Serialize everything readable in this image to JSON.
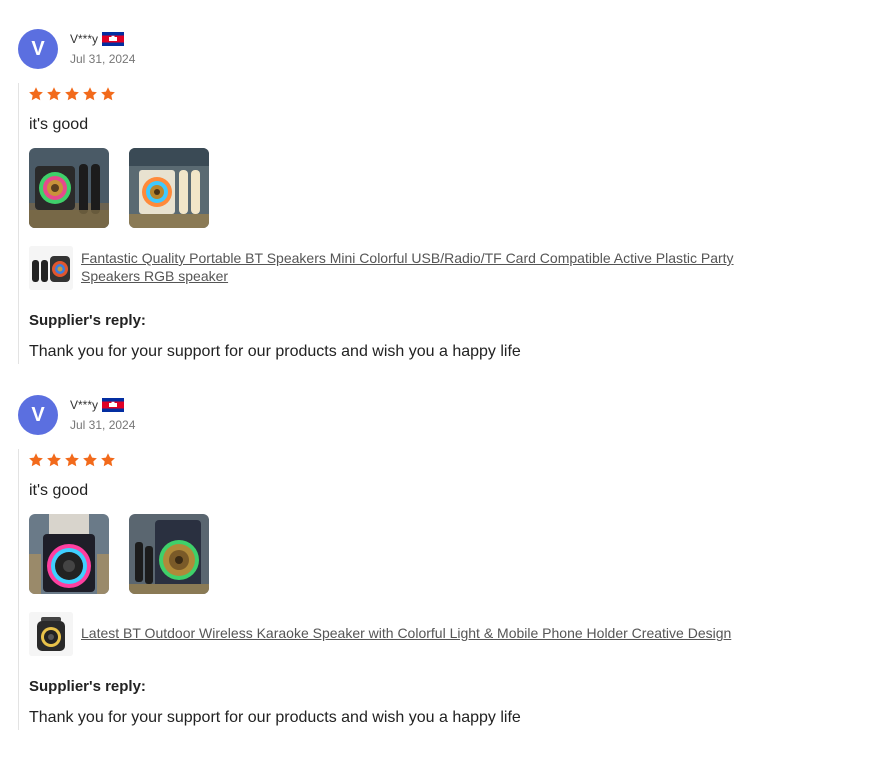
{
  "reviews": [
    {
      "avatar_letter": "V",
      "username": "V***y",
      "flag_icon": "cambodia-flag-icon",
      "date": "Jul 31, 2024",
      "rating": 5,
      "text": "it's good",
      "product_title": "Fantastic Quality Portable BT Speakers Mini Colorful USB/Radio/TF Card Compatible Active Plastic Party Speakers RGB speaker",
      "reply_label": "Supplier's reply:",
      "reply_text": "Thank you for your support for our products and wish you a happy life"
    },
    {
      "avatar_letter": "V",
      "username": "V***y",
      "flag_icon": "cambodia-flag-icon",
      "date": "Jul 31, 2024",
      "rating": 5,
      "text": "it's good",
      "product_title": "Latest BT Outdoor Wireless Karaoke Speaker with Colorful Light & Mobile Phone Holder Creative Design",
      "reply_label": "Supplier's reply:",
      "reply_text": "Thank you for your support for our products and wish you a happy life"
    }
  ],
  "colors": {
    "avatar": "#5b6fe0",
    "star": "#f26a1b",
    "link": "#555555"
  }
}
